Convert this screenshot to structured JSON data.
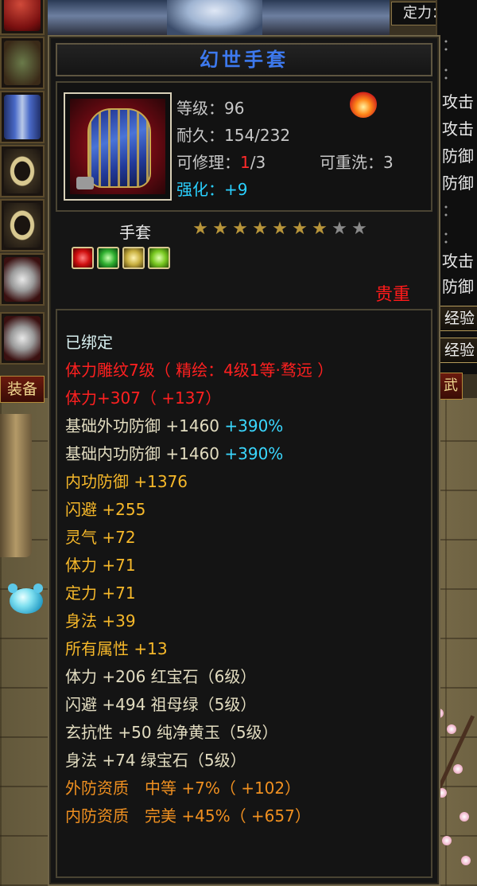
{
  "background": {
    "top_right_label": "定力：",
    "left_tab_label": "装备",
    "right_tab_label": "武",
    "right_panel_rows": [
      "攻击",
      "攻击",
      "防御",
      "防御",
      "：",
      "：",
      "攻击",
      "防御"
    ],
    "right_buttons": [
      "经验",
      "经验"
    ]
  },
  "item": {
    "name": "幻世手套",
    "level_label": "等级：",
    "level_value": "96",
    "durability_label": "耐久：",
    "durability_value": "154/232",
    "repair_label": "可修理：",
    "repair_current": "1",
    "repair_max": "/3",
    "rewash_label": "可重洗：",
    "rewash_value": "3",
    "enhance_label": "强化：",
    "enhance_value": "+9",
    "type": "手套",
    "stars_filled": 7,
    "stars_total": 9,
    "gems": [
      "red-gem-icon",
      "green-gem-icon",
      "yellow-gem-icon",
      "light-green-gem-icon"
    ],
    "rarity": "贵重"
  },
  "lines": [
    {
      "text": "已绑定",
      "extra": ""
    },
    {
      "text": "体力雕纹7级（ 精绘：4级1等·骛远 ）",
      "extra": ""
    },
    {
      "text": "体力+307（ +137）",
      "extra": ""
    },
    {
      "text": "基础外功防御 +1460 ",
      "extra": "+390%"
    },
    {
      "text": "基础内功防御 +1460 ",
      "extra": "+390%"
    },
    {
      "text": "内功防御 +1376",
      "extra": ""
    },
    {
      "text": "闪避 +255",
      "extra": ""
    },
    {
      "text": "灵气 +72",
      "extra": ""
    },
    {
      "text": "体力 +71",
      "extra": ""
    },
    {
      "text": "定力 +71",
      "extra": ""
    },
    {
      "text": "身法 +39",
      "extra": ""
    },
    {
      "text": "所有属性 +13",
      "extra": ""
    },
    {
      "text": "体力 +206 红宝石（6级）",
      "extra": ""
    },
    {
      "text": "闪避 +494 祖母绿（5级）",
      "extra": ""
    },
    {
      "text": "玄抗性 +50 纯净黄玉（5级）",
      "extra": ""
    },
    {
      "text": "身法 +74 绿宝石（5级）",
      "extra": ""
    },
    {
      "text": "外防资质　中等 +7%（ +102）",
      "extra": ""
    },
    {
      "text": "内防资质　完美 +45%（ +657）",
      "extra": ""
    }
  ],
  "colors": {
    "title": "#3d79ee",
    "bound": "#d8f0f0",
    "engrave": "#ff2020",
    "base_stat": "#e2dcc0",
    "stat": "#f6b82a",
    "percent": "#3ad8ff",
    "aptitude": "#f09020",
    "rarity": "#ff1a1a"
  }
}
